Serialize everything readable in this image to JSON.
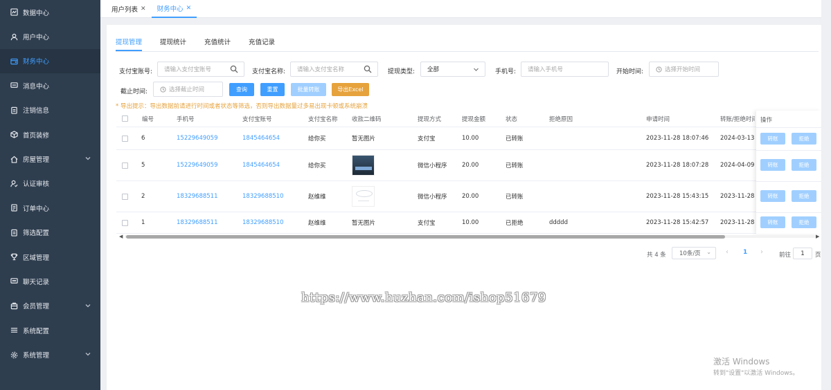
{
  "sidebar": {
    "items": [
      {
        "label": "数据中心",
        "icon": "chart-icon"
      },
      {
        "label": "用户中心",
        "icon": "user-icon"
      },
      {
        "label": "财务中心",
        "icon": "wallet-icon",
        "active": true
      },
      {
        "label": "消息中心",
        "icon": "message-icon"
      },
      {
        "label": "注销信息",
        "icon": "clipboard-icon"
      },
      {
        "label": "首页装修",
        "icon": "box-icon"
      },
      {
        "label": "房屋管理",
        "icon": "home-icon",
        "expandable": true
      },
      {
        "label": "认证审核",
        "icon": "user-check-icon"
      },
      {
        "label": "订单中心",
        "icon": "document-icon"
      },
      {
        "label": "筛选配置",
        "icon": "clipboard-icon"
      },
      {
        "label": "区域管理",
        "icon": "trophy-icon"
      },
      {
        "label": "聊天记录",
        "icon": "chat-icon"
      },
      {
        "label": "会员管理",
        "icon": "member-icon",
        "expandable": true
      },
      {
        "label": "系统配置",
        "icon": "list-icon"
      },
      {
        "label": "系统管理",
        "icon": "gear-icon",
        "expandable": true
      }
    ]
  },
  "top_tabs": [
    {
      "label": "用户列表",
      "close": "✕"
    },
    {
      "label": "财务中心",
      "close": "✕",
      "active": true
    }
  ],
  "sub_tabs": [
    "提现管理",
    "提现统计",
    "充值统计",
    "充值记录"
  ],
  "filters": {
    "alipay_account_label": "支付宝账号:",
    "alipay_account_placeholder": "请输入支付宝账号",
    "alipay_name_label": "支付宝名称:",
    "alipay_name_placeholder": "请输入支付宝名称",
    "withdraw_type_label": "提现类型:",
    "withdraw_type_value": "全部",
    "phone_label": "手机号:",
    "phone_placeholder": "请输入手机号",
    "start_time_label": "开始时间:",
    "start_time_placeholder": "选择开始时间",
    "end_time_label": "截止时间:",
    "end_time_placeholder": "选择截止时间"
  },
  "buttons": {
    "query": "查询",
    "reset": "重置",
    "batch_transfer": "批量转账",
    "export": "导出Excel"
  },
  "export_tip": "* 导出提示：导出数据前请进行时间或者状态等筛选，否则导出数据量过多易出现卡顿或系统崩溃",
  "table": {
    "headers": [
      "编号",
      "手机号",
      "支付宝账号",
      "支付宝名称",
      "收款二维码",
      "提现方式",
      "提现金额",
      "状态",
      "拒绝原因",
      "申请时间",
      "转账/拒绝时间",
      "操作"
    ],
    "rows": [
      {
        "id": "6",
        "phone": "15229649059",
        "alipay": "1845464654",
        "name": "给你买",
        "qr": "暂无图片",
        "method": "支付宝",
        "amount": "10.00",
        "status": "已转账",
        "reason": "",
        "apply_time": "2023-11-28 18:07:46",
        "done_time": "2024-03-13 1"
      },
      {
        "id": "5",
        "phone": "15229649059",
        "alipay": "1845464654",
        "name": "给你买",
        "qr": "",
        "method": "微信小程序",
        "amount": "20.00",
        "status": "已转账",
        "reason": "",
        "apply_time": "2023-11-28 18:07:28",
        "done_time": "2024-04-09 1"
      },
      {
        "id": "2",
        "phone": "18329688511",
        "alipay": "18329688510",
        "name": "赵维维",
        "qr": "",
        "method": "微信小程序",
        "amount": "20.00",
        "status": "已转账",
        "reason": "",
        "apply_time": "2023-11-28 15:43:15",
        "done_time": "2023-11-28 1"
      },
      {
        "id": "1",
        "phone": "18329688511",
        "alipay": "18329688510",
        "name": "赵维维",
        "qr": "暂无图片",
        "method": "支付宝",
        "amount": "10.00",
        "status": "已拒绝",
        "reason": "ddddd",
        "apply_time": "2023-11-28 15:42:57",
        "done_time": "2023-11-28 1"
      }
    ],
    "row_actions": {
      "transfer": "转账",
      "reject": "拒绝"
    }
  },
  "pagination": {
    "total_text": "共 4 条",
    "page_size": "10条/页",
    "current_page": "1",
    "goto_label": "前往",
    "goto_value": "1",
    "page_suffix": "页"
  },
  "watermark": "https://www.huzhan.com/ishop51679",
  "windows_activation": {
    "line1": "激活 Windows",
    "line2": "转到\"设置\"以激活 Windows。"
  },
  "colors": {
    "sidebar_bg": "#2f3e4f",
    "accent": "#409eff",
    "warning": "#e6a23c"
  }
}
